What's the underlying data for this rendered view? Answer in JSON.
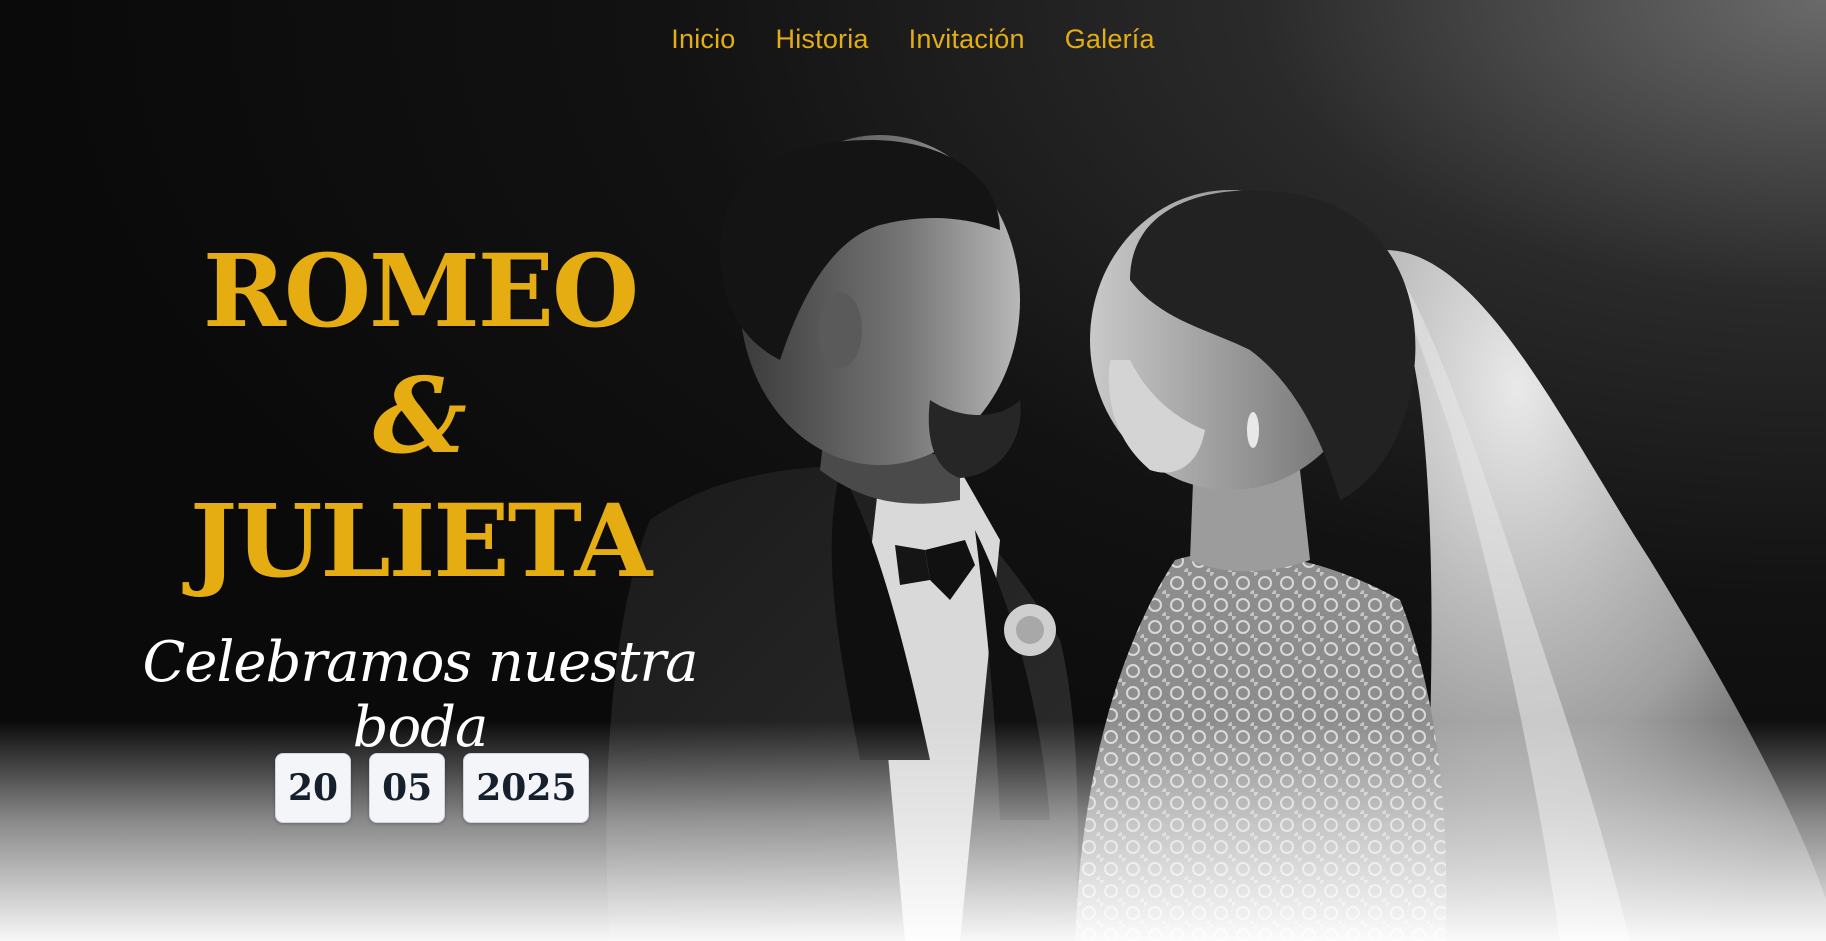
{
  "nav": {
    "items": [
      {
        "label": "Inicio"
      },
      {
        "label": "Historia"
      },
      {
        "label": "Invitación"
      },
      {
        "label": "Galería"
      }
    ]
  },
  "hero": {
    "name_1": "ROMEO",
    "ampersand": "&",
    "name_2": "JULIETA",
    "tagline": "Celebramos nuestra boda",
    "date": {
      "day": "20",
      "month": "05",
      "year": "2025"
    }
  },
  "colors": {
    "accent_gold": "#e6ad12",
    "background": "#0b0b0b",
    "date_box_bg": "#f3f5f9",
    "date_text": "#16202c"
  }
}
